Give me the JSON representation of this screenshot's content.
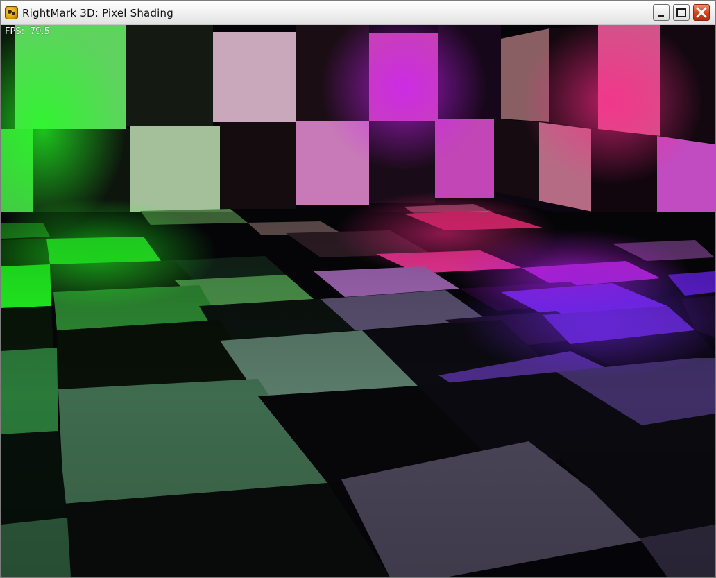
{
  "window": {
    "title": "RightMark 3D: Pixel Shading",
    "icon": "rightmark-app-icon",
    "controls": {
      "minimize": "minimize-icon",
      "maximize": "maximize-icon",
      "close": "close-icon"
    }
  },
  "overlay": {
    "fps_label": "FPS:",
    "fps_value": "79.5"
  },
  "scene": {
    "light_colors": {
      "green": "#22ff22",
      "pink": "#ff2a8a",
      "magenta": "#d020ff",
      "violet": "#7a2aff"
    }
  }
}
